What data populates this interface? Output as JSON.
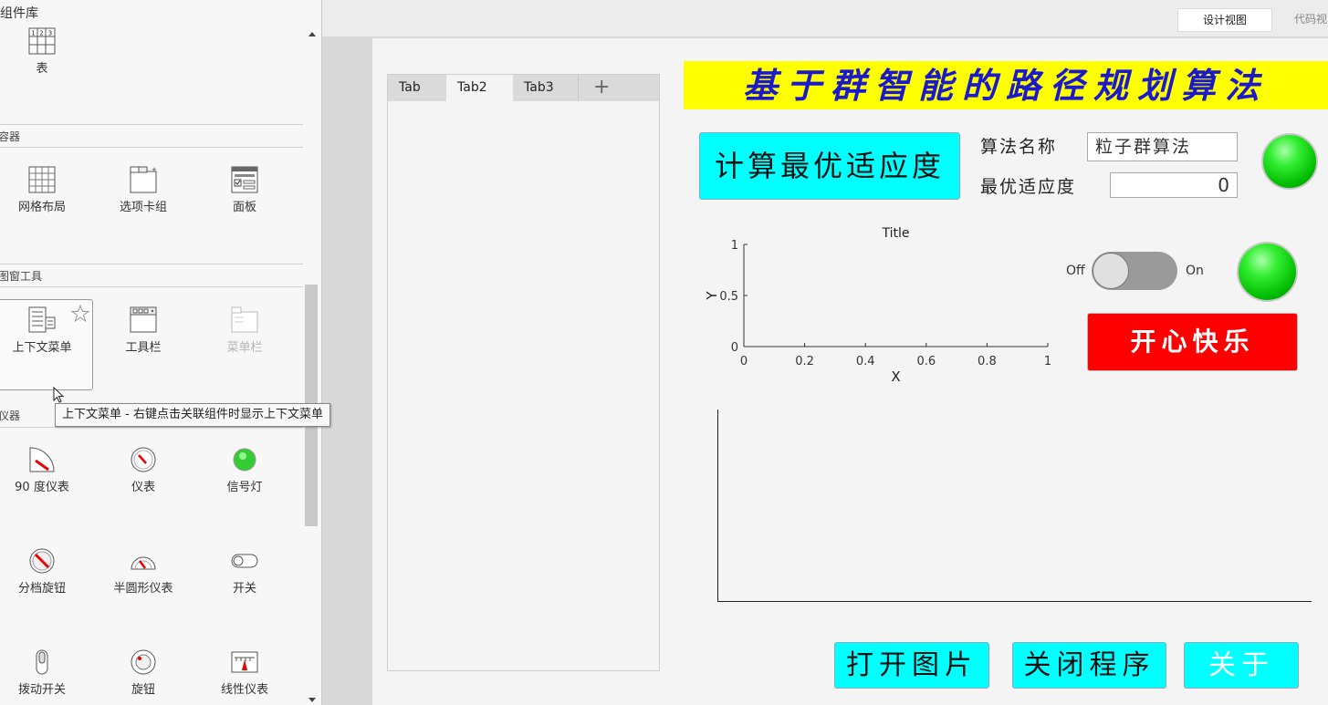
{
  "library": {
    "title": "组件库",
    "top_item": {
      "label": "表",
      "icon": "table-icon",
      "icon_text": "123"
    },
    "sections": [
      {
        "header": "容器",
        "items": [
          {
            "label": "网格布局",
            "icon": "grid-layout-icon",
            "disabled": false
          },
          {
            "label": "选项卡组",
            "icon": "tab-group-icon",
            "disabled": false
          },
          {
            "label": "面板",
            "icon": "panel-icon",
            "disabled": false
          }
        ]
      },
      {
        "header": "图窗工具",
        "items": [
          {
            "label": "上下文菜单",
            "icon": "context-menu-icon",
            "disabled": false
          },
          {
            "label": "工具栏",
            "icon": "toolbar-icon",
            "disabled": false
          },
          {
            "label": "菜单栏",
            "icon": "menubar-icon",
            "disabled": true
          }
        ]
      },
      {
        "header": "仪器",
        "items": [
          {
            "label": "90 度仪表",
            "icon": "ninety-degree-gauge-icon"
          },
          {
            "label": "仪表",
            "icon": "gauge-icon"
          },
          {
            "label": "信号灯",
            "icon": "lamp-icon"
          },
          {
            "label": "分档旋钮",
            "icon": "discrete-knob-icon"
          },
          {
            "label": "半圆形仪表",
            "icon": "semicircular-gauge-icon"
          },
          {
            "label": "开关",
            "icon": "switch-icon"
          },
          {
            "label": "拨动开关",
            "icon": "toggle-switch-icon"
          },
          {
            "label": "旋钮",
            "icon": "knob-icon"
          },
          {
            "label": "线性仪表",
            "icon": "linear-gauge-icon"
          }
        ]
      }
    ],
    "tooltip": "上下文菜单 - 右键点击关联组件时显示上下文菜单"
  },
  "view_toggle": {
    "design": "设计视图",
    "code": "代码视"
  },
  "tabs": [
    "Tab",
    "Tab2",
    "Tab3",
    "+"
  ],
  "active_tab": "Tab2",
  "app": {
    "title": "基于群智能的路径规划算法",
    "calc_button": "计算最优适应度",
    "algo_label": "算法名称",
    "algo_value": "粒子群算法",
    "fitness_label": "最优适应度",
    "fitness_value": "0",
    "switch_off": "Off",
    "switch_on": "On",
    "red_button": "开心快乐",
    "open_button": "打开图片",
    "close_button": "关闭程序",
    "about_button": "关于"
  },
  "colors": {
    "title_bg": "#ffff00",
    "title_text": "#1a1acc",
    "cyan": "#00ffff",
    "red": "#ff0000",
    "lamp": "#22dd22"
  },
  "chart_data": {
    "type": "line",
    "title": "Title",
    "xlabel": "X",
    "ylabel": "Y",
    "xlim": [
      0,
      1
    ],
    "ylim": [
      0,
      1
    ],
    "xticks": [
      "0",
      "0.2",
      "0.4",
      "0.6",
      "0.8",
      "1"
    ],
    "yticks": [
      "0",
      "0.5",
      "1"
    ],
    "series": []
  }
}
